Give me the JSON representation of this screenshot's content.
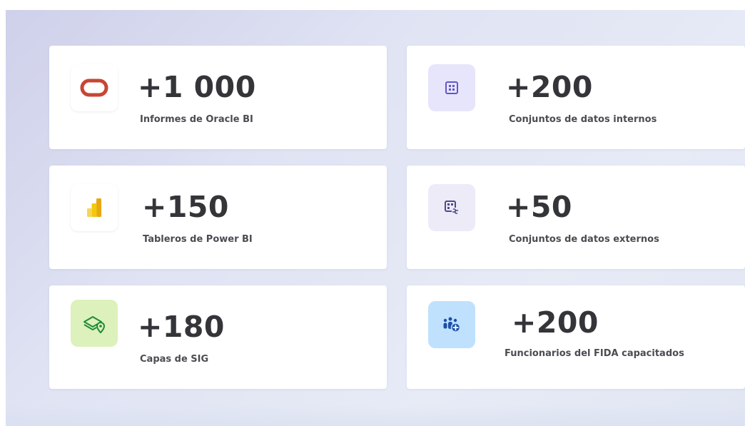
{
  "stats": [
    {
      "value": "+1 000",
      "label": "Informes de Oracle BI",
      "icon": "oracle-logo-icon"
    },
    {
      "value": "+200",
      "label": "Conjuntos de datos internos",
      "icon": "grid-icon"
    },
    {
      "value": "+150",
      "label": "Tableros de Power BI",
      "icon": "power-bi-logo-icon"
    },
    {
      "value": "+50",
      "label": "Conjuntos de datos externos",
      "icon": "linked-dataset-icon"
    },
    {
      "value": "+180",
      "label": "Capas de SIG",
      "icon": "map-layers-icon"
    },
    {
      "value": "+200",
      "label": "Funcionarios del FIDA capacitados",
      "icon": "people-add-icon"
    }
  ],
  "colors": {
    "oracle_red": "#c74634",
    "grid_purple": "#6257c9",
    "grid_bg": "#e6e5fb",
    "powerbi_yellow": "#f2c811",
    "gis_green": "#1f8a3b",
    "gis_bg": "#dcf1bb",
    "people_blue": "#1c4fa8",
    "people_bg": "#bfe1fd"
  }
}
